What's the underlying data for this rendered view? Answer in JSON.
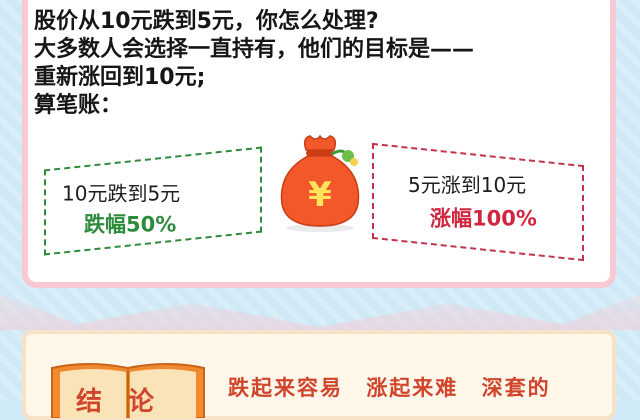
{
  "intro": {
    "lines": [
      "股价从10元跌到5元，你怎么处理?",
      "大多数人会选择一直持有，他们的目标是——",
      "重新涨回到10元;",
      "算笔账："
    ]
  },
  "box_fall": {
    "label": "10元跌到5元",
    "pct": "跌幅50%",
    "color": "#2e8b3b"
  },
  "box_rise": {
    "label": "5元涨到10元",
    "pct": "涨幅100%",
    "color": "#d0263f"
  },
  "money_bag": {
    "symbol": "¥",
    "icon": "money-bag-icon"
  },
  "conclusion": {
    "title": "结论",
    "phrases": [
      "跌起来容易",
      "涨起来难",
      "深套的"
    ]
  },
  "colors": {
    "background": "#cfeaf6",
    "card_border": "#f6c9d3",
    "bag": "#f2582a",
    "conclusion_text": "#d0452b"
  }
}
